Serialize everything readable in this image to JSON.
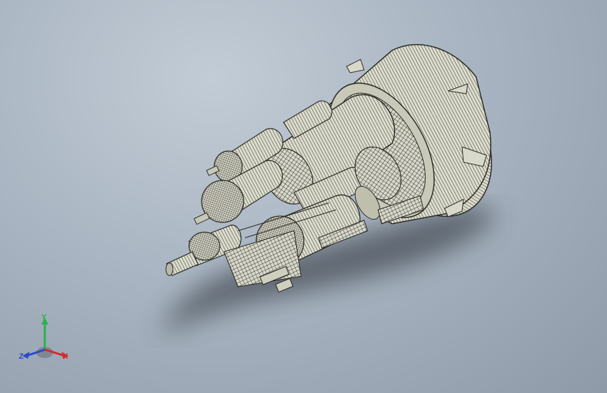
{
  "viewport": {
    "model": "rocket-engine-assembly"
  },
  "triad": {
    "y_label": "Y",
    "x_label": "X",
    "z_label": "Z",
    "y_color": "#27b34a",
    "x_color": "#d42a2a",
    "z_color": "#2b47c9"
  },
  "colors": {
    "mesh_fill": "#d9d9cb",
    "mesh_line": "#3a3a34",
    "shadow": "#3f4650"
  }
}
